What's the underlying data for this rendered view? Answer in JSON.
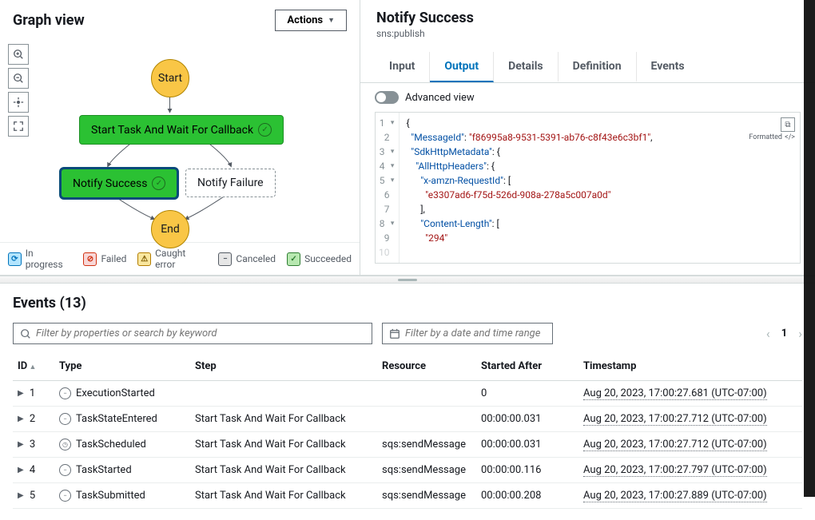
{
  "graph": {
    "title": "Graph view",
    "actions_label": "Actions",
    "nodes": {
      "start": "Start",
      "task1": "Start Task And Wait For Callback",
      "success": "Notify Success",
      "failure": "Notify Failure",
      "end": "End"
    },
    "legend": {
      "in_progress": "In progress",
      "failed": "Failed",
      "caught": "Caught error",
      "canceled": "Canceled",
      "succeeded": "Succeeded"
    }
  },
  "detail": {
    "title": "Notify Success",
    "subtitle": "sns:publish",
    "tabs": {
      "input": "Input",
      "output": "Output",
      "details": "Details",
      "definition": "Definition",
      "events": "Events"
    },
    "advanced_label": "Advanced view",
    "formatted_label": "Formatted",
    "json": {
      "msgid_key": "\"MessageId\"",
      "msgid_val": "\"f86995a8-9531-5391-ab76-c8f43e6c3bf1\"",
      "sdk_key": "\"SdkHttpMetadata\"",
      "allhttp_key": "\"AllHttpHeaders\"",
      "reqid_key": "\"x-amzn-RequestId\"",
      "reqid_val": "\"e3307ad6-f75d-526d-908a-278a5c007a0d\"",
      "len_key": "\"Content-Length\"",
      "len_val": "\"294\""
    }
  },
  "events": {
    "title_prefix": "Events",
    "count": "13",
    "filter_placeholder": "Filter by properties or search by keyword",
    "date_placeholder": "Filter by a date and time range",
    "page": "1",
    "columns": {
      "id": "ID",
      "type": "Type",
      "step": "Step",
      "resource": "Resource",
      "started": "Started After",
      "timestamp": "Timestamp"
    },
    "rows": [
      {
        "id": "1",
        "type": "ExecutionStarted",
        "icon": "−",
        "step": "",
        "resource": "",
        "started": "0",
        "ts": "Aug 20, 2023, 17:00:27.681 (UTC-07:00)"
      },
      {
        "id": "2",
        "type": "TaskStateEntered",
        "icon": "−",
        "step": "Start Task And Wait For Callback",
        "resource": "",
        "started": "00:00:00.031",
        "ts": "Aug 20, 2023, 17:00:27.712 (UTC-07:00)"
      },
      {
        "id": "3",
        "type": "TaskScheduled",
        "icon": "◷",
        "step": "Start Task And Wait For Callback",
        "resource": "sqs:sendMessage",
        "started": "00:00:00.031",
        "ts": "Aug 20, 2023, 17:00:27.712 (UTC-07:00)"
      },
      {
        "id": "4",
        "type": "TaskStarted",
        "icon": "−",
        "step": "Start Task And Wait For Callback",
        "resource": "sqs:sendMessage",
        "started": "00:00:00.116",
        "ts": "Aug 20, 2023, 17:00:27.797 (UTC-07:00)"
      },
      {
        "id": "5",
        "type": "TaskSubmitted",
        "icon": "−",
        "step": "Start Task And Wait For Callback",
        "resource": "sqs:sendMessage",
        "started": "00:00:00.208",
        "ts": "Aug 20, 2023, 17:00:27.889 (UTC-07:00)"
      }
    ]
  }
}
